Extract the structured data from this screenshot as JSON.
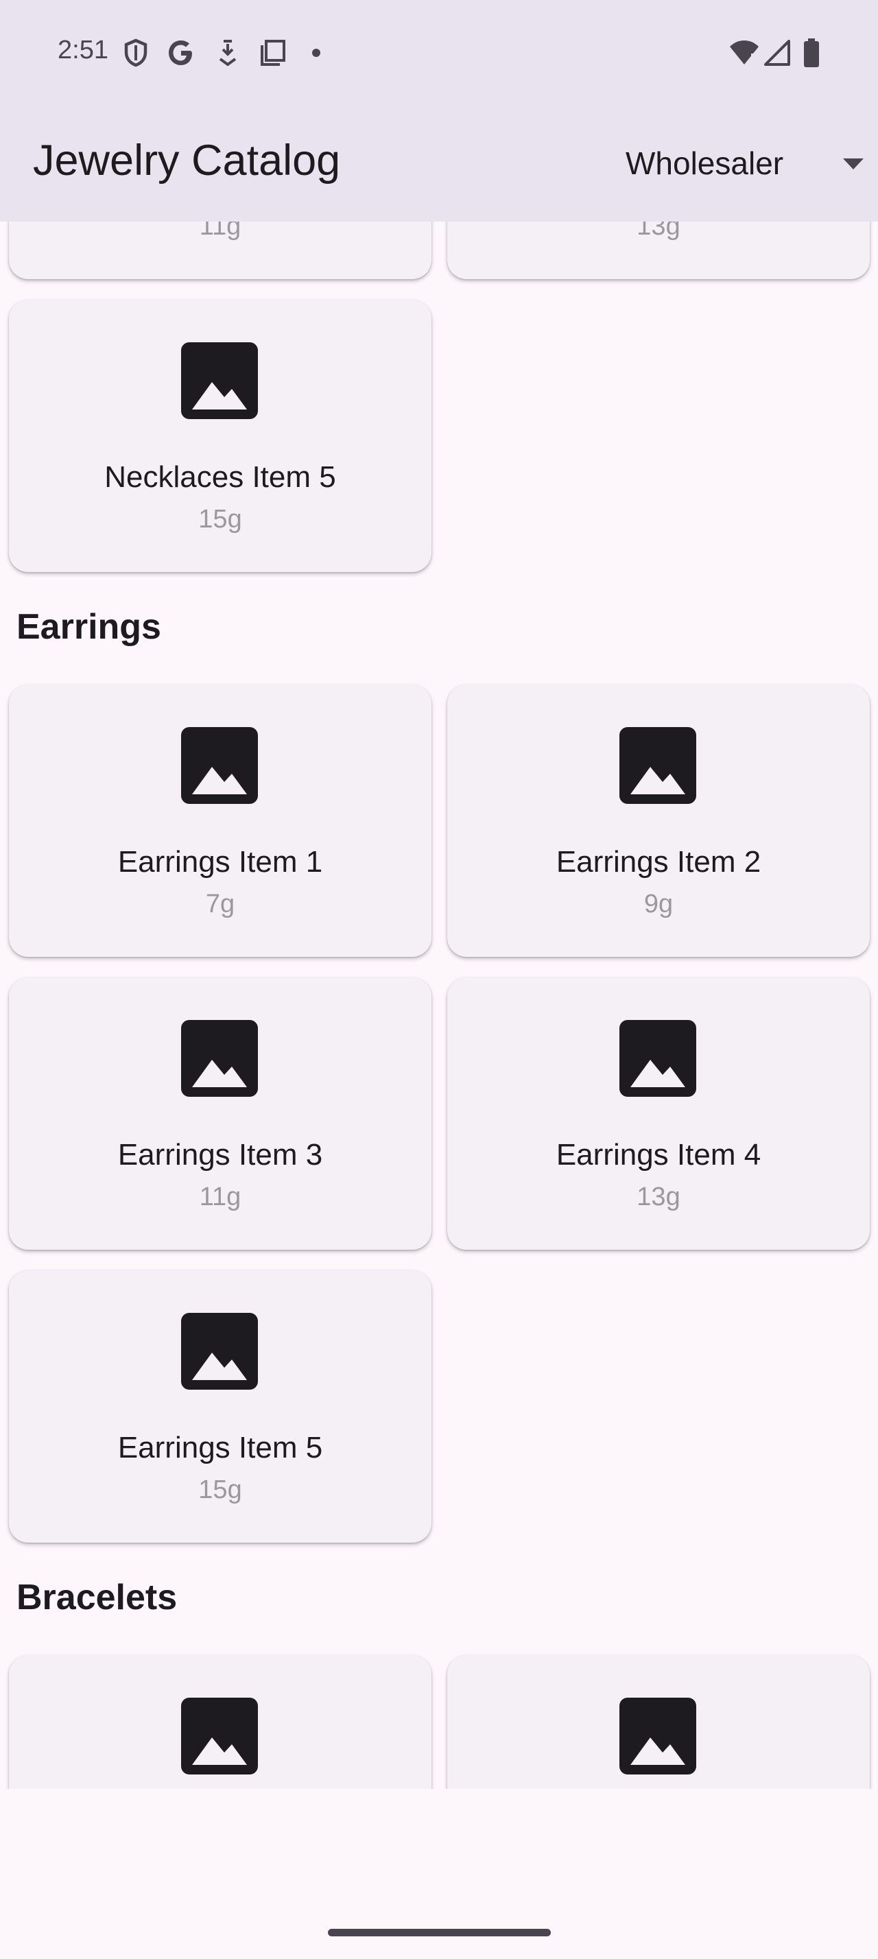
{
  "status_bar": {
    "time": "2:51",
    "left_icons": [
      "shield-icon",
      "google-icon",
      "download-icon",
      "copy-icon",
      "dot-icon"
    ],
    "right_icons": [
      "wifi-icon",
      "signal-icon",
      "battery-icon"
    ]
  },
  "app_bar": {
    "title": "Jewelry Catalog",
    "role_selector": {
      "selected": "Wholesaler"
    }
  },
  "sections": {
    "necklaces": {
      "items": [
        {
          "weight": "11g"
        },
        {
          "weight": "13g"
        },
        {
          "name": "Necklaces Item 5",
          "weight": "15g"
        }
      ]
    },
    "earrings": {
      "title": "Earrings",
      "items": [
        {
          "name": "Earrings Item 1",
          "weight": "7g"
        },
        {
          "name": "Earrings Item 2",
          "weight": "9g"
        },
        {
          "name": "Earrings Item 3",
          "weight": "11g"
        },
        {
          "name": "Earrings Item 4",
          "weight": "13g"
        },
        {
          "name": "Earrings Item 5",
          "weight": "15g"
        }
      ]
    },
    "bracelets": {
      "title": "Bracelets"
    }
  },
  "colors": {
    "app_bar_bg": "#e8e3ee",
    "page_bg": "#fdf7fc",
    "card_bg": "#f4f0f5",
    "weight_text": "#9a979e",
    "icon": "#1d1b20"
  }
}
